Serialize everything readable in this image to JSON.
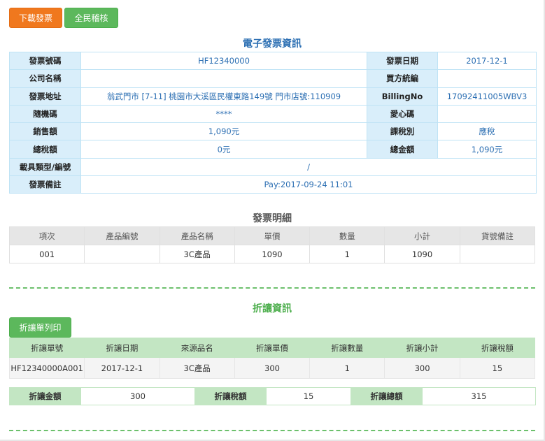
{
  "toolbar": {
    "download_label": "下載發票",
    "tax_audit_label": "全民稽核"
  },
  "invoice_info": {
    "title": "電子發票資訊",
    "invoice_no_label": "發票號碼",
    "invoice_no": "HF12340000",
    "invoice_date_label": "發票日期",
    "invoice_date": "2017-12-1",
    "company_label": "公司名稱",
    "company": "",
    "buyer_id_label": "買方統編",
    "buyer_id": "",
    "address_label": "發票地址",
    "address": "翁武門市 [7-11] 桃園市大溪區民權東路149號 門市店號:110909",
    "billing_label": "BillingNo",
    "billing_no": "17092411005WBV3",
    "random_label": "隨機碼",
    "random_code": "****",
    "love_code_label": "愛心碼",
    "love_code": "",
    "sales_label": "銷售額",
    "sales": "1,090元",
    "tax_type_label": "課稅別",
    "tax_type": "應稅",
    "tax_label": "總稅額",
    "tax": "0元",
    "total_label": "總金額",
    "total": "1,090元",
    "carrier_label": "載具類型/編號",
    "carrier": "/",
    "remark_label": "發票備註",
    "remark": "Pay:2017-09-24 11:01"
  },
  "detail": {
    "title": "發票明細",
    "headers": [
      "項次",
      "產品編號",
      "產品名稱",
      "單價",
      "數量",
      "小計",
      "貨號備註"
    ],
    "rows": [
      [
        "001",
        "",
        "3C產品",
        "1090",
        "1",
        "1090",
        ""
      ]
    ]
  },
  "allowance": {
    "title": "折讓資訊",
    "print_label": "折讓單列印",
    "headers": [
      "折讓單號",
      "折讓日期",
      "來源品名",
      "折讓單價",
      "折讓數量",
      "折讓小計",
      "折讓稅額"
    ],
    "rows": [
      [
        "HF12340000A001",
        "2017-12-1",
        "3C產品",
        "300",
        "1",
        "300",
        "15"
      ]
    ],
    "amount_label": "折讓金額",
    "amount": "300",
    "tax_label": "折讓稅額",
    "tax": "15",
    "total_label": "折讓總額",
    "total": "315"
  },
  "colors": {
    "orange_button": "#f0781e",
    "green_button": "#5cb85c",
    "blue_text": "#2c6fb3",
    "info_label_bg": "#d9eefa",
    "allowance_header_bg": "#c3e6c3"
  }
}
